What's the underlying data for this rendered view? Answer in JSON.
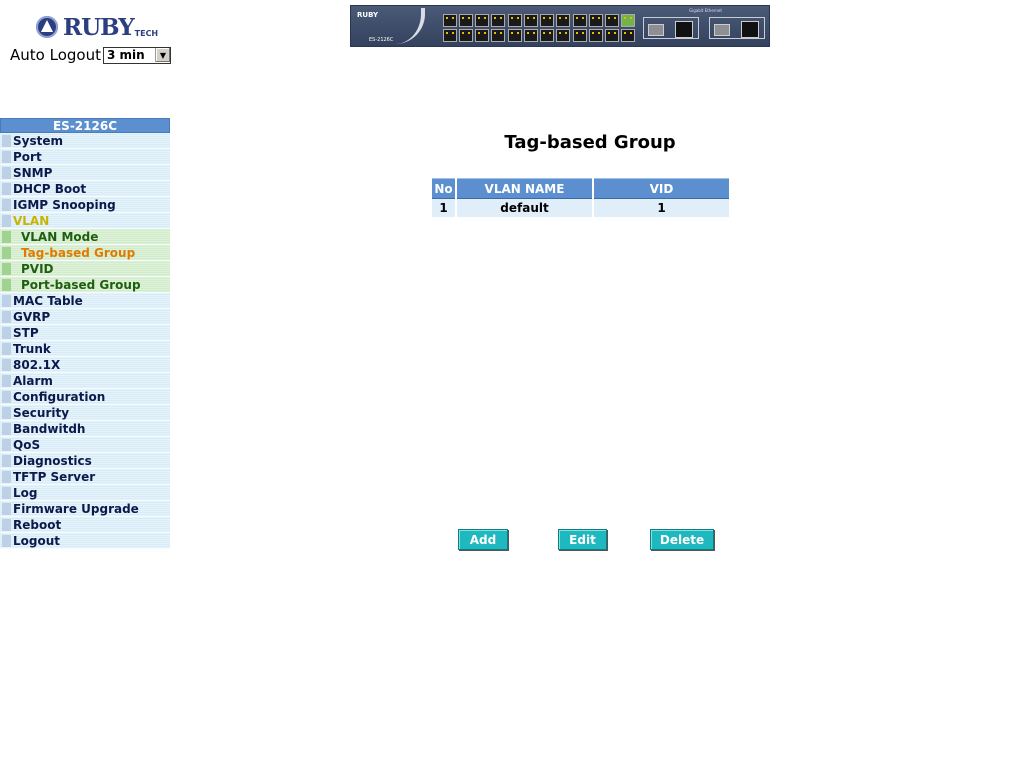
{
  "header": {
    "logo_text": "RUBY",
    "logo_sub": "TECH",
    "auto_logout_label": "Auto Logout",
    "auto_logout_value": "3 min"
  },
  "device": {
    "icon": "switch-front-panel-image",
    "brand": "RUBY",
    "model": "ES-2126C",
    "gigabit_label": "Gigabit Ethernet"
  },
  "sidebar": {
    "title": "ES-2126C",
    "items": [
      {
        "label": "System"
      },
      {
        "label": "Port"
      },
      {
        "label": "SNMP"
      },
      {
        "label": "DHCP Boot"
      },
      {
        "label": "IGMP Snooping"
      },
      {
        "label": "VLAN",
        "active": true
      },
      {
        "label": "VLAN Mode",
        "sub": true
      },
      {
        "label": "Tag-based Group",
        "sub": true,
        "selected": true
      },
      {
        "label": "PVID",
        "sub": true
      },
      {
        "label": "Port-based Group",
        "sub": true
      },
      {
        "label": "MAC Table"
      },
      {
        "label": "GVRP"
      },
      {
        "label": "STP"
      },
      {
        "label": "Trunk"
      },
      {
        "label": "802.1X"
      },
      {
        "label": "Alarm"
      },
      {
        "label": "Configuration"
      },
      {
        "label": "Security"
      },
      {
        "label": "Bandwitdh"
      },
      {
        "label": "QoS"
      },
      {
        "label": "Diagnostics"
      },
      {
        "label": "TFTP Server"
      },
      {
        "label": "Log"
      },
      {
        "label": "Firmware Upgrade"
      },
      {
        "label": "Reboot"
      },
      {
        "label": "Logout"
      }
    ]
  },
  "main": {
    "title": "Tag-based Group",
    "table": {
      "headers": [
        "No",
        "VLAN NAME",
        "VID"
      ],
      "rows": [
        [
          "1",
          "default",
          "1"
        ]
      ]
    },
    "buttons": {
      "add": "Add",
      "edit": "Edit",
      "delete": "Delete"
    }
  },
  "colors": {
    "header_blue": "#5b8fcf",
    "button_teal": "#1fb8bf",
    "menu_active": "#c8b400",
    "menu_selected": "#e07a00"
  }
}
